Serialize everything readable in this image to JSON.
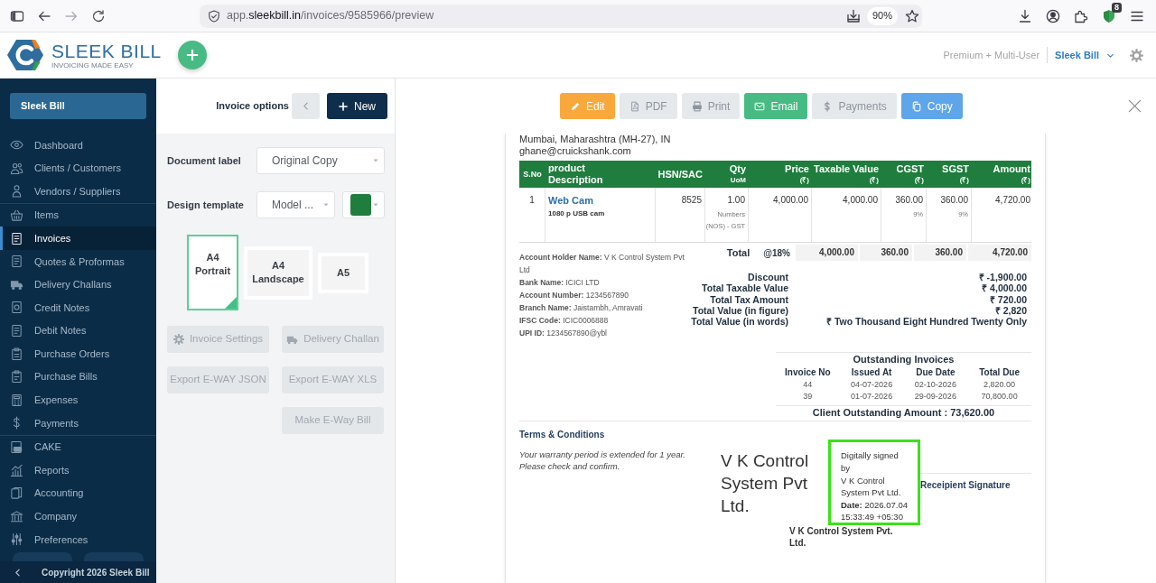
{
  "browser": {
    "url": {
      "subdomain": "app.",
      "domain": "sleekbill.in",
      "path": "/invoices/9585966/preview"
    },
    "zoom": "90%",
    "extension_badge": "8"
  },
  "header": {
    "logo": {
      "name": "SLEEK BILL",
      "tagline": "INVOICING MADE EASY"
    },
    "plan": "Premium + Multi-User",
    "account": "Sleek Bill"
  },
  "sidebar": {
    "account_button": "Sleek Bill",
    "groups": [
      {
        "items": [
          {
            "label": "Dashboard",
            "selected": false
          },
          {
            "label": "Clients / Customers",
            "selected": false
          },
          {
            "label": "Vendors / Suppliers",
            "selected": false
          }
        ]
      },
      {
        "items": [
          {
            "label": "Items",
            "selected": false
          },
          {
            "label": "Invoices",
            "selected": true
          },
          {
            "label": "Quotes & Proformas",
            "selected": false
          },
          {
            "label": "Delivery Challans",
            "selected": false
          },
          {
            "label": "Credit Notes",
            "selected": false
          },
          {
            "label": "Debit Notes",
            "selected": false
          },
          {
            "label": "Purchase Orders",
            "selected": false
          },
          {
            "label": "Purchase Bills",
            "selected": false
          },
          {
            "label": "Expenses",
            "selected": false
          },
          {
            "label": "Payments",
            "selected": false
          }
        ]
      },
      {
        "items": [
          {
            "label": "CAKE",
            "selected": false
          },
          {
            "label": "Reports",
            "selected": false
          },
          {
            "label": "Accounting",
            "selected": false
          },
          {
            "label": "Company",
            "selected": false
          },
          {
            "label": "Preferences",
            "selected": false
          }
        ]
      }
    ],
    "copyright": "Copyright 2026 Sleek Bill"
  },
  "options_panel": {
    "title": "Invoice options",
    "new_button": "New",
    "document_label": {
      "label": "Document label",
      "value": "Original Copy"
    },
    "design_template": {
      "label": "Design template",
      "value": "Model ...",
      "color": "#1f7d3e"
    },
    "page_sizes": [
      {
        "label": "A4 Portrait",
        "selected": true
      },
      {
        "label": "A4 Landscape",
        "selected": false
      },
      {
        "label": "A5",
        "selected": false
      }
    ],
    "action_rows": [
      [
        {
          "label": "Invoice Settings",
          "kind": "settings",
          "disabled": true
        },
        {
          "label": "Delivery Challan",
          "kind": "challan",
          "disabled": true
        }
      ],
      [
        {
          "label": "Export E-WAY JSON",
          "kind": "plain",
          "disabled": true
        },
        {
          "label": "Export E-WAY XLS",
          "kind": "plain",
          "disabled": true
        }
      ],
      [
        {
          "label": "Make E-Way Bill",
          "kind": "plain",
          "disabled": true
        }
      ]
    ]
  },
  "toolbar": {
    "buttons": [
      {
        "label": "Edit",
        "kind": "edit"
      },
      {
        "label": "PDF",
        "kind": "pdf"
      },
      {
        "label": "Print",
        "kind": "print"
      },
      {
        "label": "Email",
        "kind": "email"
      },
      {
        "label": "Payments",
        "kind": "payments"
      },
      {
        "label": "Copy",
        "kind": "copy"
      }
    ]
  },
  "invoice": {
    "client": {
      "address": "Mumbai, Maharashtra (MH-27), IN",
      "email": "ghane@cruickshank.com"
    },
    "table": {
      "columns": [
        {
          "label": "S.No"
        },
        {
          "label": "product Description"
        },
        {
          "label": "HSN/SAC"
        },
        {
          "label": "Qty",
          "unit": "UoM"
        },
        {
          "label": "Price",
          "unit": "(₹)"
        },
        {
          "label": "Taxable Value",
          "unit": "(₹)"
        },
        {
          "label": "CGST",
          "unit": "(₹)"
        },
        {
          "label": "SGST",
          "unit": "(₹)"
        },
        {
          "label": "Amount",
          "unit": "(₹)"
        }
      ],
      "rows": [
        {
          "sno": "1",
          "item": "Web Cam",
          "description": "1080 p USB cam",
          "hsn_sac": "8525",
          "qty": "1.00",
          "uom": "Numbers (NOS) - GST",
          "price": "4,000.00",
          "taxable_value": "4,000.00",
          "cgst": "360.00",
          "cgst_rate": "9%",
          "sgst": "360.00",
          "sgst_rate": "9%",
          "amount": "4,720.00"
        }
      ],
      "total": {
        "label": "Total",
        "rate": "@18%",
        "values": [
          "4,000.00",
          "360.00",
          "360.00",
          "4,720.00"
        ]
      }
    },
    "bank_details": [
      "**Account Holder Name:** V K Control System Pvt Ltd",
      "**Bank Name:** ICICI LTD",
      "**Account Number:** 1234567890",
      "**Branch Name:** Jaistambh, Amravati",
      "**IFSC Code:** ICIC0006888",
      "**UPI ID:** 1234567890@ybl"
    ],
    "summary": [
      {
        "label": "Discount",
        "value": "₹ -1,900.00"
      },
      {
        "label": "Total Taxable Value",
        "value": "₹ 4,000.00"
      },
      {
        "label": "Total Tax Amount",
        "value": "₹ 720.00"
      },
      {
        "label": "Total Value (in figure)",
        "value": "₹ 2,820"
      },
      {
        "label": "Total Value (in words)",
        "value": "₹ Two Thousand Eight Hundred Twenty Only"
      }
    ],
    "outstanding": {
      "title": "Outstanding Invoices",
      "columns": [
        "Invoice No",
        "Issued At",
        "Due Date",
        "Total Due"
      ],
      "rows": [
        [
          "44",
          "04-07-2026",
          "02-10-2026",
          "2,820.00"
        ],
        [
          "39",
          "01-07-2026",
          "29-09-2026",
          "70,800.00"
        ]
      ],
      "total": "Client Outstanding Amount : 73,620.00"
    },
    "terms": {
      "title": "Terms & Conditions",
      "lines": [
        "Your warranty period is extended for 1 year.",
        "Please check and confirm."
      ]
    },
    "signature": {
      "company": "V K Control System Pvt Ltd.",
      "stamp_lines": [
        "Digitally signed",
        "by",
        "V K Control",
        "System Pvt Ltd.",
        "**Date:** 2026.07.04",
        "15:33:49 +05:30"
      ],
      "signatory": "V K Control System Pvt. Ltd.",
      "recipient_label": "Receipient Signature"
    }
  }
}
